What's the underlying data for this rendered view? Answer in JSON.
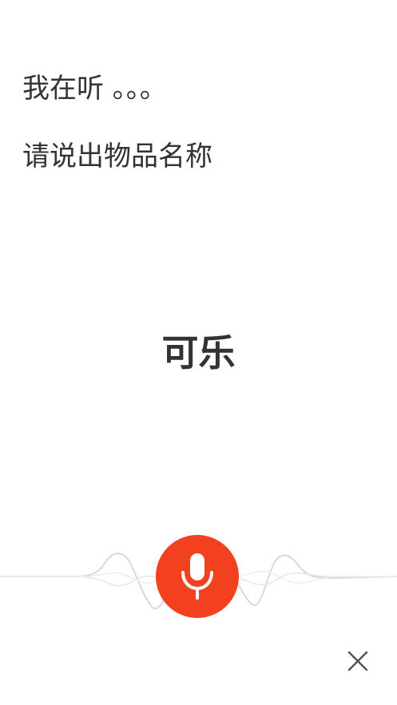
{
  "listening": {
    "status_text": "我在听 。。。",
    "prompt_text": "请说出物品名称"
  },
  "result": {
    "recognized_text": "可乐"
  },
  "controls": {
    "mic_icon": "microphone-icon",
    "close_icon": "close-icon"
  },
  "colors": {
    "accent": "#f3401f",
    "text": "#333333",
    "wave": "#d6d6d6"
  }
}
